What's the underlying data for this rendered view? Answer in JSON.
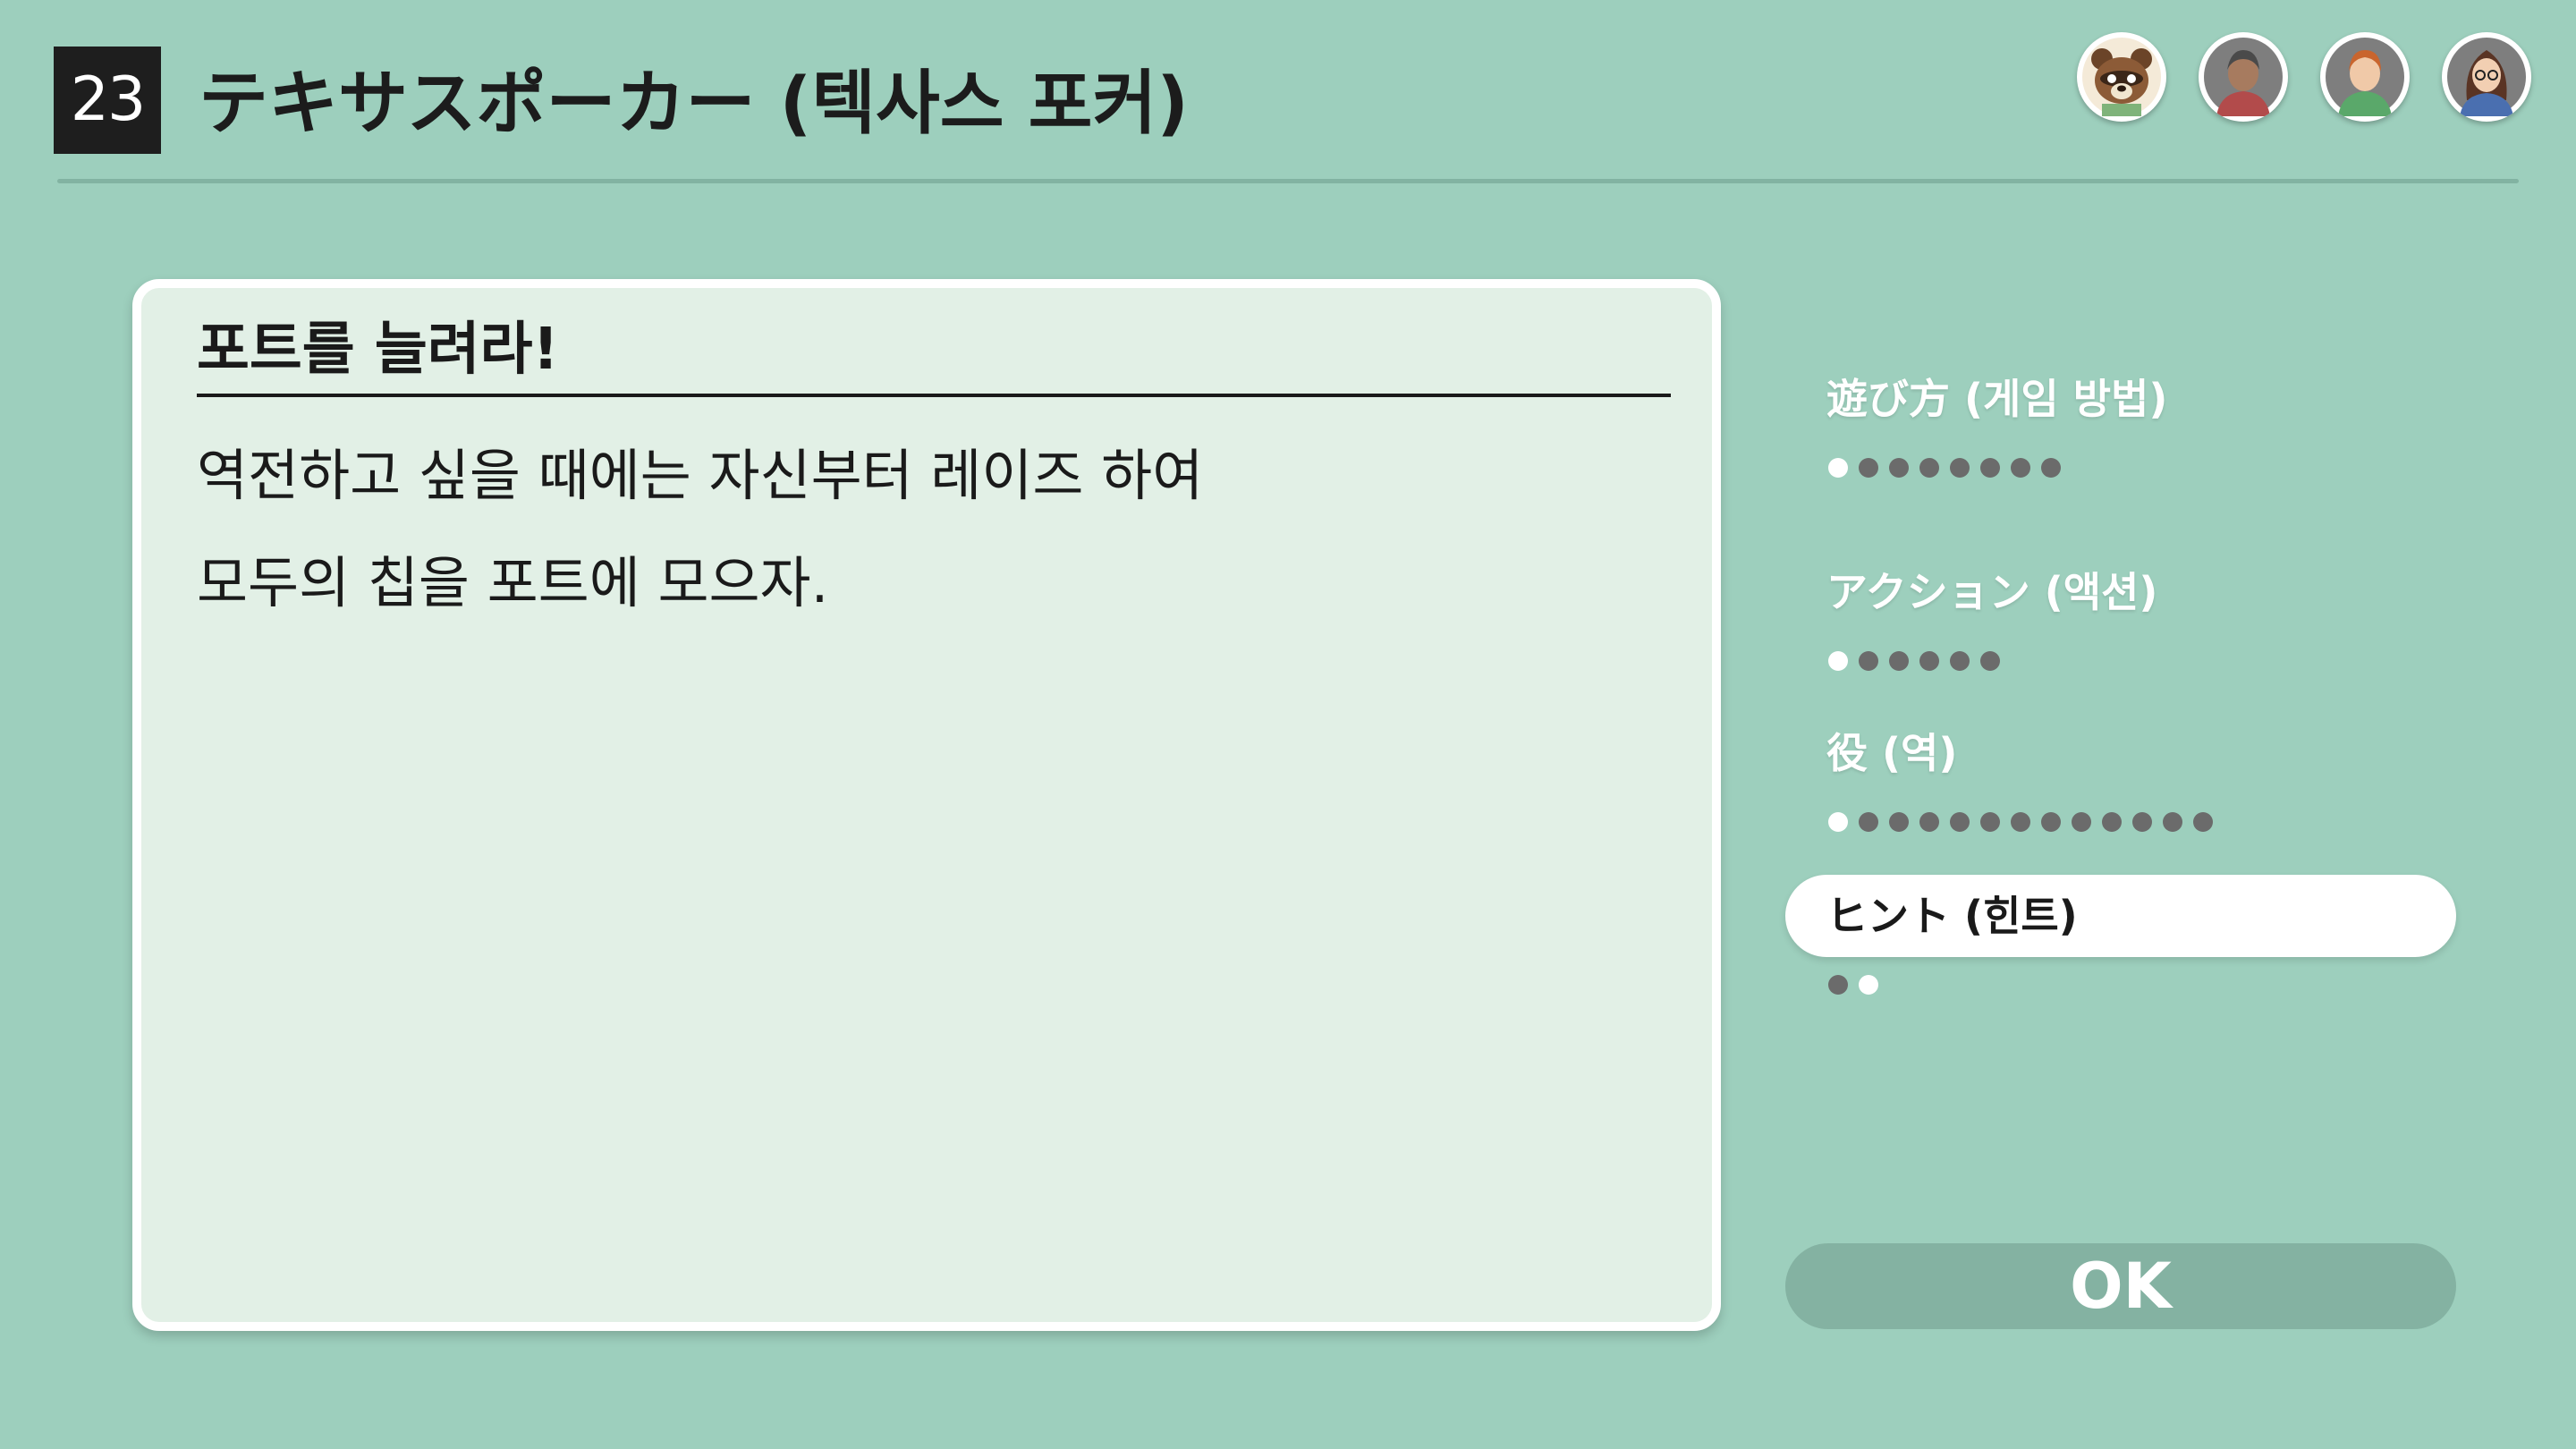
{
  "header": {
    "game_number": "23",
    "title": "テキサスポーカー (텍사스 포커)"
  },
  "players": [
    {
      "name": "tom-nook-avatar",
      "hair": "#8a5a3c"
    },
    {
      "name": "gray-player-avatar",
      "hair": "#4a4a4a"
    },
    {
      "name": "ginger-player-avatar",
      "hair": "#c9652e"
    },
    {
      "name": "glasses-player-avatar",
      "hair": "#5a3424"
    }
  ],
  "content": {
    "heading": "포트를 늘려라!",
    "lines": [
      "역전하고 싶을 때에는 자신부터 레이즈 하여",
      "모두의 칩을 포트에 모으자."
    ]
  },
  "menu": {
    "items": [
      {
        "label": "遊び方 (게임 방법)",
        "pages": 8,
        "current_page": 0,
        "active": false
      },
      {
        "label": "アクション (액션)",
        "pages": 6,
        "current_page": 0,
        "active": false
      },
      {
        "label": "役 (역)",
        "pages": 13,
        "current_page": 0,
        "active": false
      },
      {
        "label": "ヒント (힌트)",
        "pages": 2,
        "current_page": 1,
        "active": true
      }
    ]
  },
  "ok_button": {
    "label": "OK"
  },
  "colors": {
    "background": "#9dcfbd",
    "panel": "#e2f0e6",
    "button": "#84b2a2",
    "dot": "#6b6b6b",
    "dot_current": "#ffffff"
  }
}
